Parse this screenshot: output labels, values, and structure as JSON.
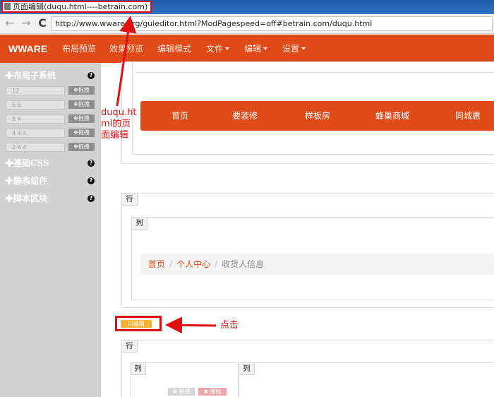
{
  "window": {
    "title": "页面编辑(duqu.html----betrain.com)"
  },
  "browser": {
    "back_icon": "←",
    "forward_icon": "→",
    "reload_icon": "C",
    "url": "http://www.wware.org/guieditor.html?ModPagespeed=off#betrain.com/duqu.html"
  },
  "navbar": {
    "brand": "WWARE",
    "items": [
      {
        "label": "布局预览"
      },
      {
        "label": "效果预览"
      },
      {
        "label": "编辑模式"
      },
      {
        "label": "文件",
        "dropdown": true
      },
      {
        "label": "编辑",
        "dropdown": true
      },
      {
        "label": "设置",
        "dropdown": true
      }
    ]
  },
  "sidebar": {
    "layout_system": "✚布局子系统",
    "help": "?",
    "rows": [
      {
        "value": "12",
        "drag": "✥拖拽"
      },
      {
        "value": "6 6",
        "drag": "✥拖拽"
      },
      {
        "value": "8 4",
        "drag": "✥拖拽"
      },
      {
        "value": "4 4 4",
        "drag": "✥拖拽"
      },
      {
        "value": "2 6 4",
        "drag": "✥拖拽"
      }
    ],
    "base_css": "✚基础CSS",
    "static_components": "✚静态组件",
    "script_blocks": "✚脚本区块"
  },
  "content": {
    "top_nav": [
      "首页",
      "要装修",
      "样板房",
      "蜂巢商城",
      "同城惠"
    ],
    "row_label": "行",
    "col_label": "列",
    "breadcrumb": {
      "home": "首页",
      "sep": "/",
      "center": "个人中心",
      "current": "收货人信息"
    },
    "edit_button": "☑编辑",
    "ghost_drag": "✥ 拖拽",
    "ghost_delete": "✖ 删除"
  },
  "annotations": {
    "arrow_text": "duqu.ht\nml的页\n面编辑",
    "click": "点击"
  },
  "colors": {
    "accent": "#e04a18",
    "annotation": "#e01010",
    "edit": "#f2b23a"
  }
}
